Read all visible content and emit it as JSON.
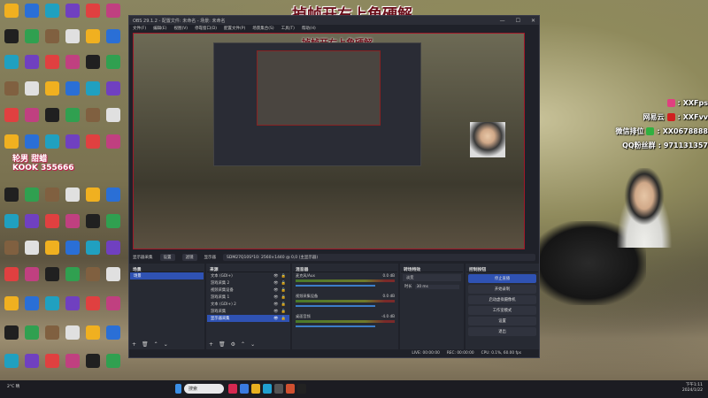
{
  "banner_title": "掉帧开右上角硬解",
  "obs": {
    "title": "OBS 29.1.2 - 配置文件: 未命名 - 场景: 未命名",
    "menu": [
      "文件(F)",
      "编辑(E)",
      "视图(V)",
      "停靠窗口(D)",
      "配置文件(P)",
      "场景集合(S)",
      "工具(T)",
      "帮助(H)"
    ],
    "window_controls": [
      "—",
      "☐",
      "✕"
    ],
    "scenebar": {
      "source": "显示器采集",
      "properties": "设置",
      "filters": "滤镜",
      "display_label": "显示器",
      "display_value": "SDM27Q10S*10: 2560×1440 @ 0,0 (主显示器)"
    },
    "docks": {
      "scenes": {
        "title": "场景",
        "items": [
          "场景"
        ]
      },
      "sources": {
        "title": "来源",
        "items": [
          "文本 (GDI+)",
          "游戏采集 2",
          "视频采集设备",
          "游戏采集 1",
          "文本 (GDI+) 2",
          "游戏采集",
          "显示器采集"
        ]
      },
      "mixer": {
        "title": "混音器",
        "channels": [
          {
            "name": "麦克风/Aux",
            "db": "0.0 dB"
          },
          {
            "name": "视频采集设备",
            "db": "0.0 dB"
          },
          {
            "name": "桌面音频",
            "db": "-4.0 dB"
          }
        ]
      },
      "transitions": {
        "title": "转场特效",
        "type": "淡变",
        "duration_label": "时长",
        "duration": "30 ms"
      },
      "controls": {
        "title": "控制按钮",
        "buttons": [
          "停止直播",
          "开始录制",
          "启动虚拟摄像机",
          "工作室模式",
          "设置",
          "退出"
        ]
      }
    },
    "status": {
      "live": "LIVE: 00:00:00",
      "rec": "REC: 00:00:00",
      "cpu": "CPU: 0.1%, 60.00 fps"
    }
  },
  "overlay": [
    {
      "label": "",
      "value": "XXFps",
      "color": "#e04080"
    },
    {
      "label": "网易云",
      "value": "XXFvv",
      "color": "#d02020"
    },
    {
      "label": "微信排位",
      "value": "XX0678888",
      "color": "#30b040"
    },
    {
      "label": "QQ粉丝群",
      "value": "971131357",
      "color": ""
    }
  ],
  "desktop_promo": {
    "line1": "轮男 甜蜡",
    "line2": "KOOK 355666"
  },
  "taskbar": {
    "search_placeholder": "搜索",
    "weather": "2°C 晴",
    "time": "下午1:11",
    "date": "2024/1/22"
  },
  "palette": [
    "#2a6fd6",
    "#e04040",
    "#30a050",
    "#f0b020",
    "#7040c0",
    "#202020",
    "#e0e0e0",
    "#20a0c0",
    "#c04080",
    "#806040"
  ]
}
